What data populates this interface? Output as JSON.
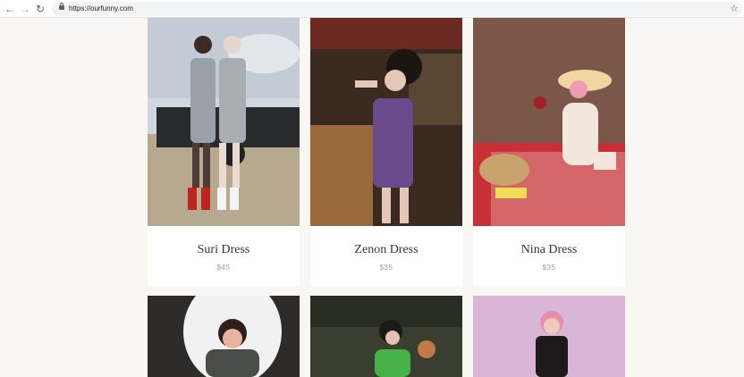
{
  "browser": {
    "url": "https://ourfunny.com",
    "back_icon": "arrow-left-icon",
    "forward_icon": "arrow-right-icon",
    "reload_icon": "reload-icon",
    "bookmark_icon": "star-icon"
  },
  "products": [
    {
      "name": "Suri Dress",
      "price": "$45"
    },
    {
      "name": "Zenon Dress",
      "price": "$35"
    },
    {
      "name": "Nina Dress",
      "price": "$35"
    }
  ],
  "colors": {
    "page_background": "#f8f7f3",
    "card_background": "#ffffff",
    "title": "#333333",
    "price": "#9b9b9b"
  }
}
